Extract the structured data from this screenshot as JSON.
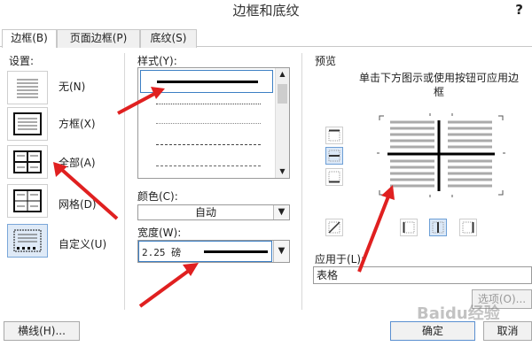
{
  "window": {
    "title": "边框和底纹",
    "help": "?"
  },
  "tabs": [
    {
      "label": "边框(B)",
      "active": true
    },
    {
      "label": "页面边框(P)",
      "active": false
    },
    {
      "label": "底纹(S)",
      "active": false
    }
  ],
  "settings": {
    "label": "设置:",
    "items": [
      {
        "label": "无(N)",
        "icon": "setting-none-icon",
        "selected": false
      },
      {
        "label": "方框(X)",
        "icon": "setting-box-icon",
        "selected": false
      },
      {
        "label": "全部(A)",
        "icon": "setting-all-icon",
        "selected": false
      },
      {
        "label": "网格(D)",
        "icon": "setting-grid-icon",
        "selected": false
      },
      {
        "label": "自定义(U)",
        "icon": "setting-custom-icon",
        "selected": true
      }
    ]
  },
  "style": {
    "label": "样式(Y):",
    "options": [
      "solid-thick",
      "dotted",
      "dotted-fine",
      "dashed",
      "dash-dot"
    ]
  },
  "color": {
    "label": "颜色(C):",
    "value": "自动"
  },
  "width": {
    "label": "宽度(W):",
    "value": "2.25 磅"
  },
  "preview": {
    "label": "预览",
    "hint": "单击下方图示或使用按钮可应用边框"
  },
  "apply_to": {
    "label": "应用于(L):",
    "value": "表格"
  },
  "buttons": {
    "options": "选项(O)...",
    "horizontal_line": "横线(H)...",
    "ok": "确定",
    "cancel": "取消"
  },
  "watermark": "Baidu经验",
  "colors": {
    "accent": "#6d9fd6",
    "arrow": "#e02020",
    "selected_bg": "#dbe8f7"
  }
}
